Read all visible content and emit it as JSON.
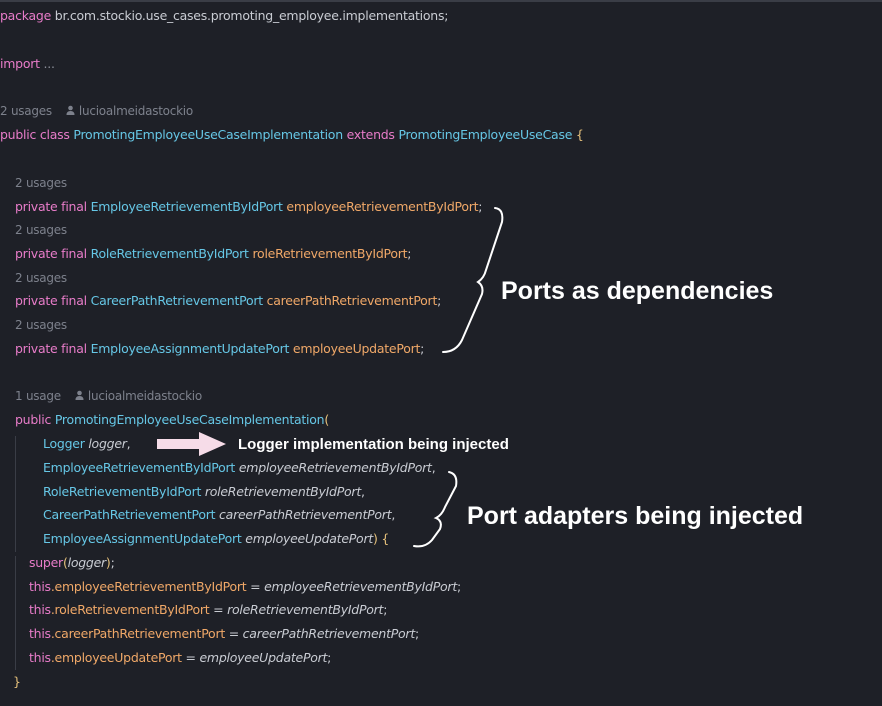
{
  "package_line": {
    "keyword": "package",
    "name": "br.com.stockio.use_cases.promoting_employee.implementations;"
  },
  "import_line": {
    "keyword": "import",
    "folded": "..."
  },
  "class_hint": {
    "usages": "2 usages",
    "author": "lucioalmeidastockio"
  },
  "class_decl": {
    "public": "public",
    "class": "class",
    "name": "PromotingEmployeeUseCaseImplementation",
    "extends": "extends",
    "parent": "PromotingEmployeeUseCase",
    "brace": "{"
  },
  "fields": [
    {
      "usages": "2 usages",
      "modifiers": "private final",
      "type": "EmployeeRetrievementByIdPort",
      "name": "employeeRetrievementByIdPort",
      "semi": ";"
    },
    {
      "usages": "2 usages",
      "modifiers": "private final",
      "type": "RoleRetrievementByIdPort",
      "name": "roleRetrievementByIdPort",
      "semi": ";"
    },
    {
      "usages": "2 usages",
      "modifiers": "private final",
      "type": "CareerPathRetrievementPort",
      "name": "careerPathRetrievementPort",
      "semi": ";"
    },
    {
      "usages": "2 usages",
      "modifiers": "private final",
      "type": "EmployeeAssignmentUpdatePort",
      "name": "employeeUpdatePort",
      "semi": ";"
    }
  ],
  "ctor_hint": {
    "usages": "1 usage",
    "author": "lucioalmeidastockio"
  },
  "ctor_decl": {
    "public": "public",
    "name": "PromotingEmployeeUseCaseImplementation",
    "paren": "("
  },
  "params": [
    {
      "type": "Logger",
      "name": "logger",
      "sep": ","
    },
    {
      "type": "EmployeeRetrievementByIdPort",
      "name": "employeeRetrievementByIdPort",
      "sep": ","
    },
    {
      "type": "RoleRetrievementByIdPort",
      "name": "roleRetrievementByIdPort",
      "sep": ","
    },
    {
      "type": "CareerPathRetrievementPort",
      "name": "careerPathRetrievementPort",
      "sep": ","
    },
    {
      "type": "EmployeeAssignmentUpdatePort",
      "name": "employeeUpdatePort",
      "sep": ")",
      "brace": " {"
    }
  ],
  "super_call": {
    "keyword": "super",
    "open": "(",
    "arg": "logger",
    "close": ")",
    "semi": ";"
  },
  "assignments": [
    {
      "this": "this",
      "field": ".employeeRetrievementByIdPort",
      "eq": " = ",
      "value": "employeeRetrievementByIdPort",
      "semi": ";"
    },
    {
      "this": "this",
      "field": ".roleRetrievementByIdPort",
      "eq": " = ",
      "value": "roleRetrievementByIdPort",
      "semi": ";"
    },
    {
      "this": "this",
      "field": ".careerPathRetrievementPort",
      "eq": " = ",
      "value": "careerPathRetrievementPort",
      "semi": ";"
    },
    {
      "this": "this",
      "field": ".employeeUpdatePort",
      "eq": " = ",
      "value": "employeeUpdatePort",
      "semi": ";"
    }
  ],
  "close_brace": "}",
  "annotations": {
    "ports": "Ports as dependencies",
    "logger": "Logger implementation being injected",
    "adapters": "Port adapters being injected"
  },
  "icons": {
    "author": "person-icon",
    "arrow": "right-arrow-icon",
    "brace": "curly-brace-icon"
  },
  "colors": {
    "background": "#1e2027",
    "keyword": "#e87cc9",
    "type": "#66c7e6",
    "field": "#f0a868",
    "hint": "#7d818c",
    "text": "#c9ccd3",
    "annotation": "#ffffff"
  }
}
